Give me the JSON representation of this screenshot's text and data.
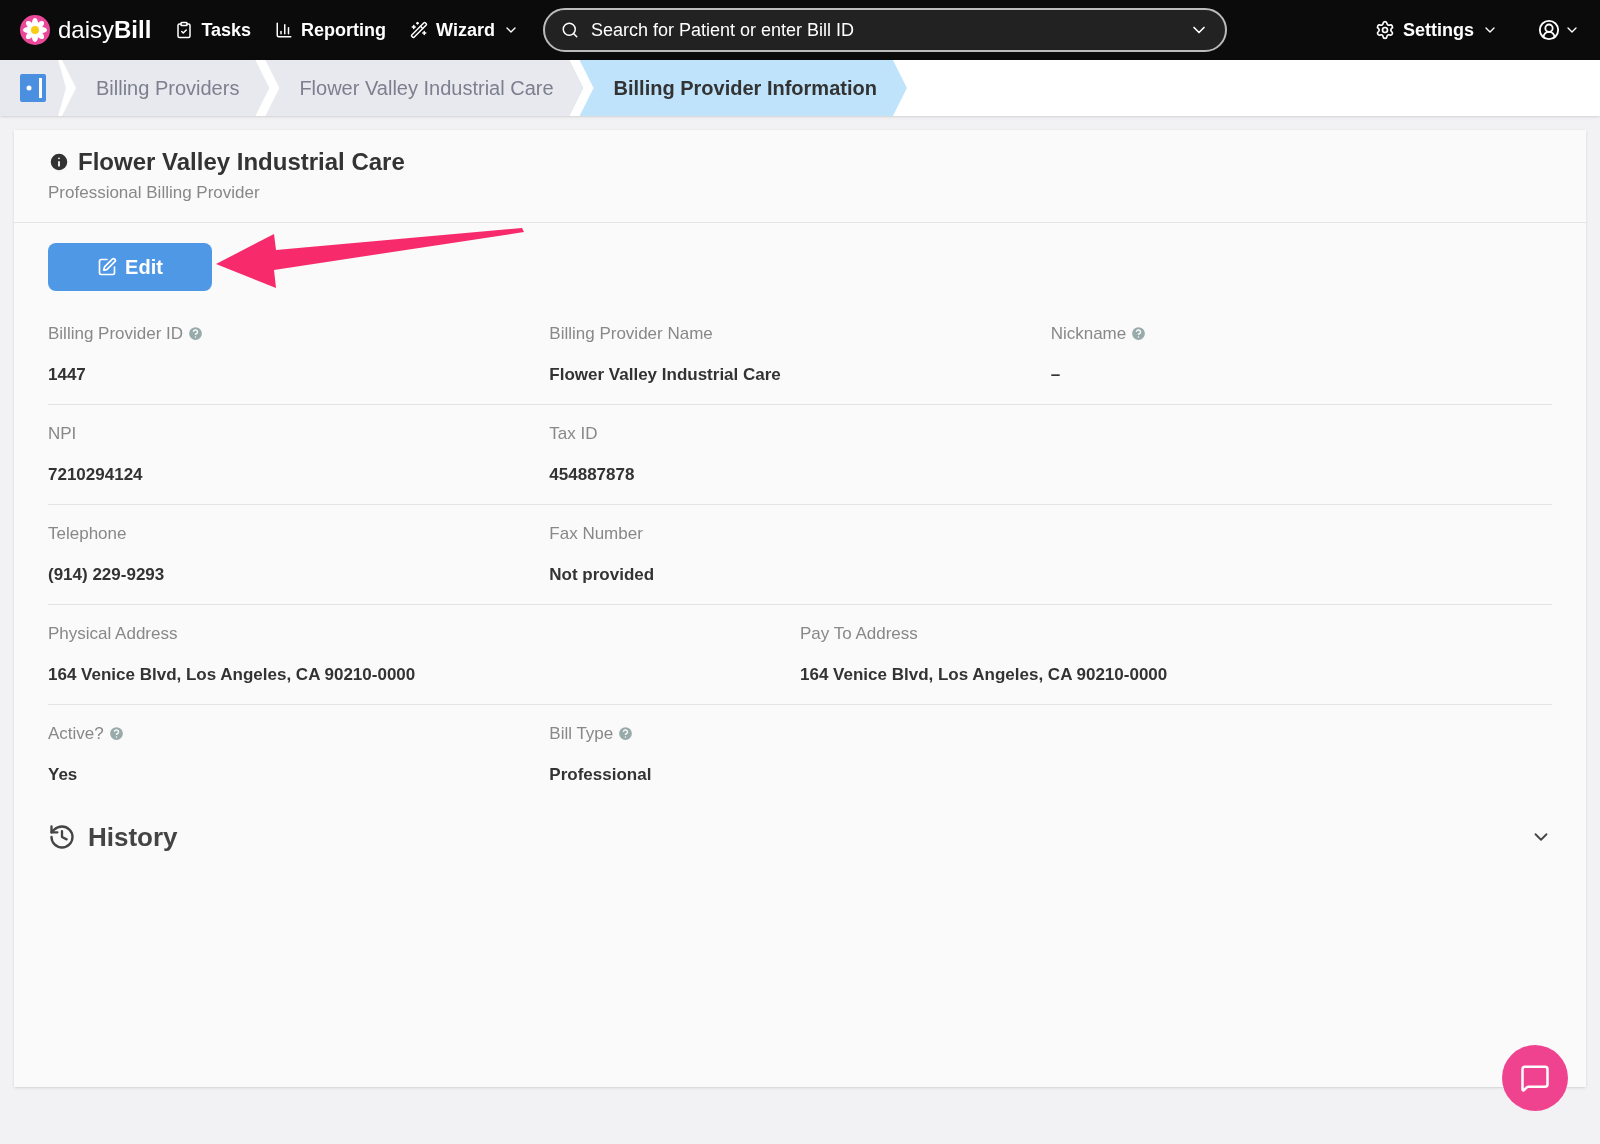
{
  "nav": {
    "brand": {
      "light": "daisy",
      "bold": "Bill"
    },
    "items": [
      {
        "label": "Tasks",
        "kind": "tasks",
        "dropdown": false
      },
      {
        "label": "Reporting",
        "kind": "reporting",
        "dropdown": false
      },
      {
        "label": "Wizard",
        "kind": "wizard",
        "dropdown": true
      }
    ],
    "search": {
      "placeholder": "Search for Patient or enter Bill ID"
    },
    "settings": {
      "label": "Settings"
    }
  },
  "breadcrumbs": [
    {
      "label": "Billing Providers",
      "selected": false
    },
    {
      "label": "Flower Valley Industrial Care",
      "selected": false
    },
    {
      "label": "Billing Provider Information",
      "selected": true
    }
  ],
  "header": {
    "title": "Flower Valley Industrial Care",
    "subtitle": "Professional Billing Provider"
  },
  "edit_button": {
    "label": "Edit"
  },
  "rows": [
    {
      "kind": "three",
      "fields": [
        {
          "label": "Billing Provider ID",
          "value": "1447",
          "help": true
        },
        {
          "label": "Billing Provider Name",
          "value": "Flower Valley Industrial Care",
          "help": false
        },
        {
          "label": "Nickname",
          "value": "–",
          "help": true
        }
      ]
    },
    {
      "kind": "three",
      "fields": [
        {
          "label": "NPI",
          "value": "7210294124",
          "help": false
        },
        {
          "label": "Tax ID",
          "value": "454887878",
          "help": false
        }
      ]
    },
    {
      "kind": "three",
      "fields": [
        {
          "label": "Telephone",
          "value": "(914) 229-9293",
          "help": false
        },
        {
          "label": "Fax Number",
          "value": "Not provided",
          "help": false
        }
      ]
    },
    {
      "kind": "two",
      "fields": [
        {
          "label": "Physical Address",
          "value": "164 Venice Blvd, Los Angeles, CA 90210-0000",
          "help": false
        },
        {
          "label": "Pay To Address",
          "value": "164 Venice Blvd, Los Angeles, CA 90210-0000",
          "help": false
        }
      ]
    },
    {
      "kind": "three",
      "fields": [
        {
          "label": "Active?",
          "value": "Yes",
          "help": true
        },
        {
          "label": "Bill Type",
          "value": "Professional",
          "help": true
        }
      ]
    }
  ],
  "history": {
    "title": "History",
    "expanded": false
  }
}
